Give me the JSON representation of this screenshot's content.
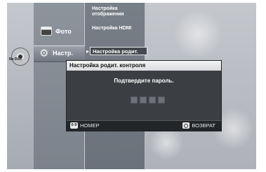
{
  "disc": {
    "label": "No Disc"
  },
  "main_menu": {
    "foto": {
      "label": "Фото",
      "icon": "photo-icon"
    },
    "setup": {
      "label": "Настр.",
      "icon": "gear-icon"
    }
  },
  "sub_menu": {
    "items": [
      {
        "label": "Настройка отображения"
      },
      {
        "label": "Настройка HDMI"
      },
      {
        "label": "Настройка родит."
      }
    ]
  },
  "dialog": {
    "title": "Настройка родит. контроля",
    "message": "Подтвердите пароль.",
    "password_length": 4,
    "footer": {
      "number_key_icon": "0-9",
      "number_label": "НОМЕР",
      "return_label": "ВОЗВРАТ"
    }
  }
}
